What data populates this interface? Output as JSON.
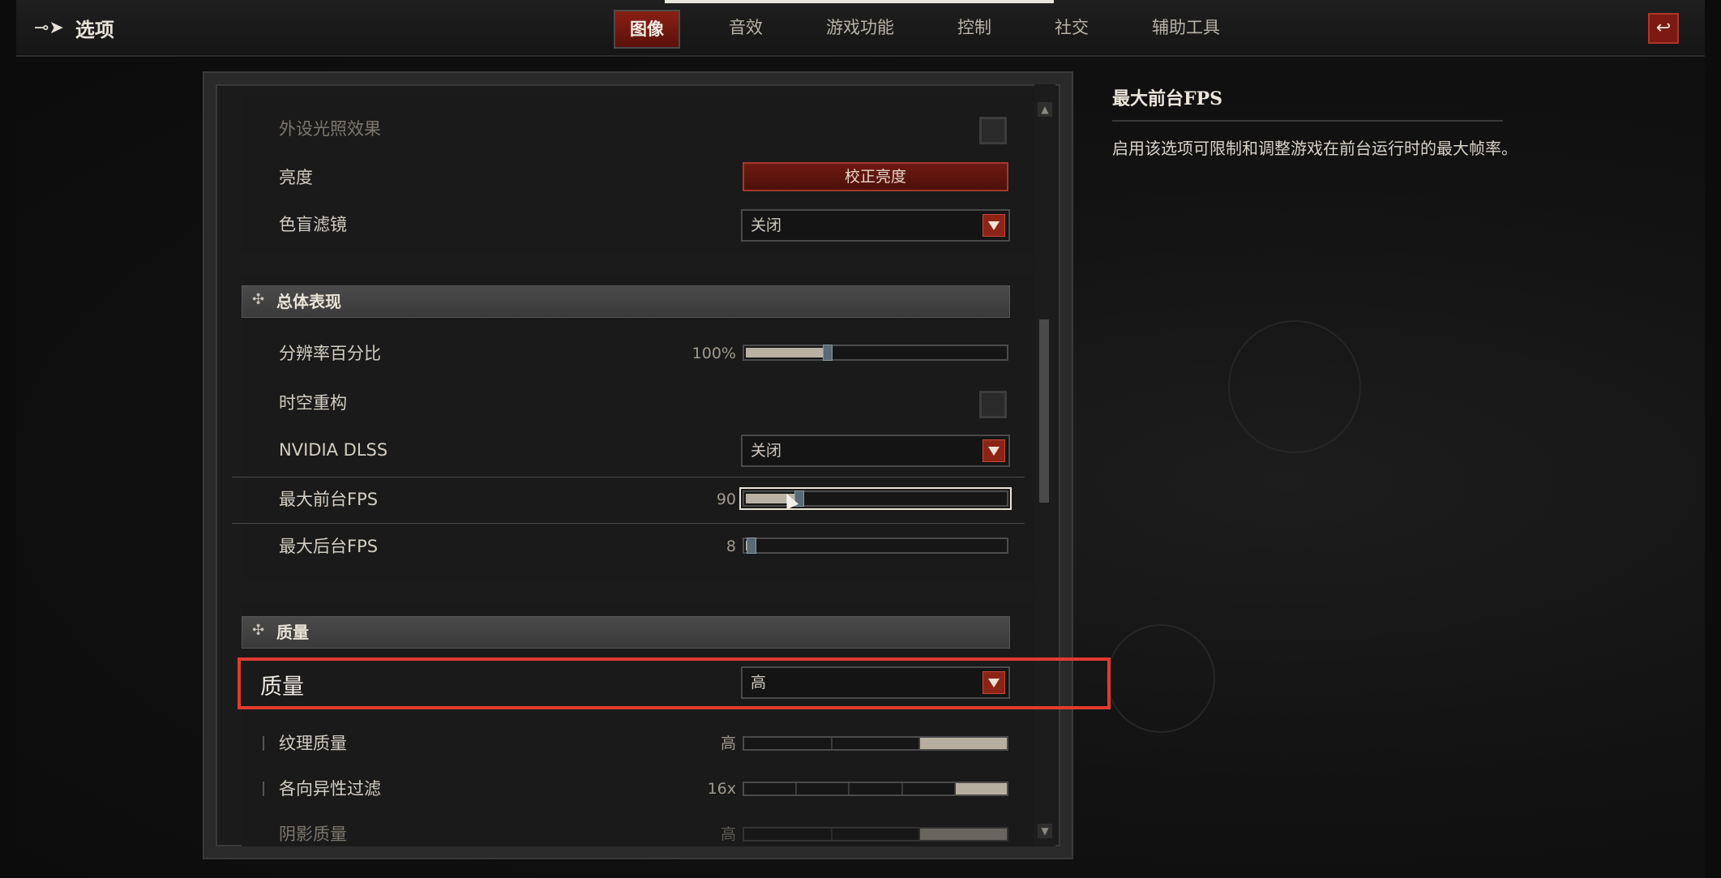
{
  "window": {
    "title": "选项"
  },
  "tabs": [
    {
      "label": "图像",
      "active": true
    },
    {
      "label": "音效",
      "active": false
    },
    {
      "label": "游戏功能",
      "active": false
    },
    {
      "label": "控制",
      "active": false
    },
    {
      "label": "社交",
      "active": false
    },
    {
      "label": "辅助工具",
      "active": false
    }
  ],
  "display_section": {
    "peripheral_lighting": {
      "label": "外设光照效果",
      "checked": false
    },
    "brightness": {
      "label": "亮度",
      "button_label": "校正亮度"
    },
    "colorblind": {
      "label": "色盲滤镜",
      "value": "关闭"
    }
  },
  "performance_section": {
    "title": "总体表现",
    "resolution_percent": {
      "label": "分辨率百分比",
      "value_text": "100%",
      "fraction": 0.3
    },
    "temporal_reconstruction": {
      "label": "时空重构",
      "checked": false
    },
    "nvidia_dlss": {
      "label": "NVIDIA DLSS",
      "value": "关闭"
    },
    "max_foreground_fps": {
      "label": "最大前台FPS",
      "value_text": "90",
      "fraction": 0.2
    },
    "max_background_fps": {
      "label": "最大后台FPS",
      "value_text": "8",
      "fraction": 0.02
    }
  },
  "quality_section": {
    "title": "质量",
    "quality": {
      "label": "质量",
      "value": "高"
    },
    "texture_quality": {
      "label": "纹理质量",
      "value_text": "高",
      "level": 3,
      "levels": 3
    },
    "anisotropic": {
      "label": "各向异性过滤",
      "value_text": "16x",
      "level": 5,
      "levels": 5
    },
    "shadow_quality": {
      "label": "阴影质量",
      "value_text": "高"
    }
  },
  "info_panel": {
    "title": "最大前台FPS",
    "description": "启用该选项可限制和调整游戏在前台运行时的最大帧率。"
  },
  "colors": {
    "accent_red": "#8c2317",
    "highlight_box": "#e23a2e"
  },
  "icons": {
    "title_icon": "arrow-right-icon",
    "back_icon": "return-arrow-icon",
    "dropdown_icon": "triangle-down-icon"
  }
}
